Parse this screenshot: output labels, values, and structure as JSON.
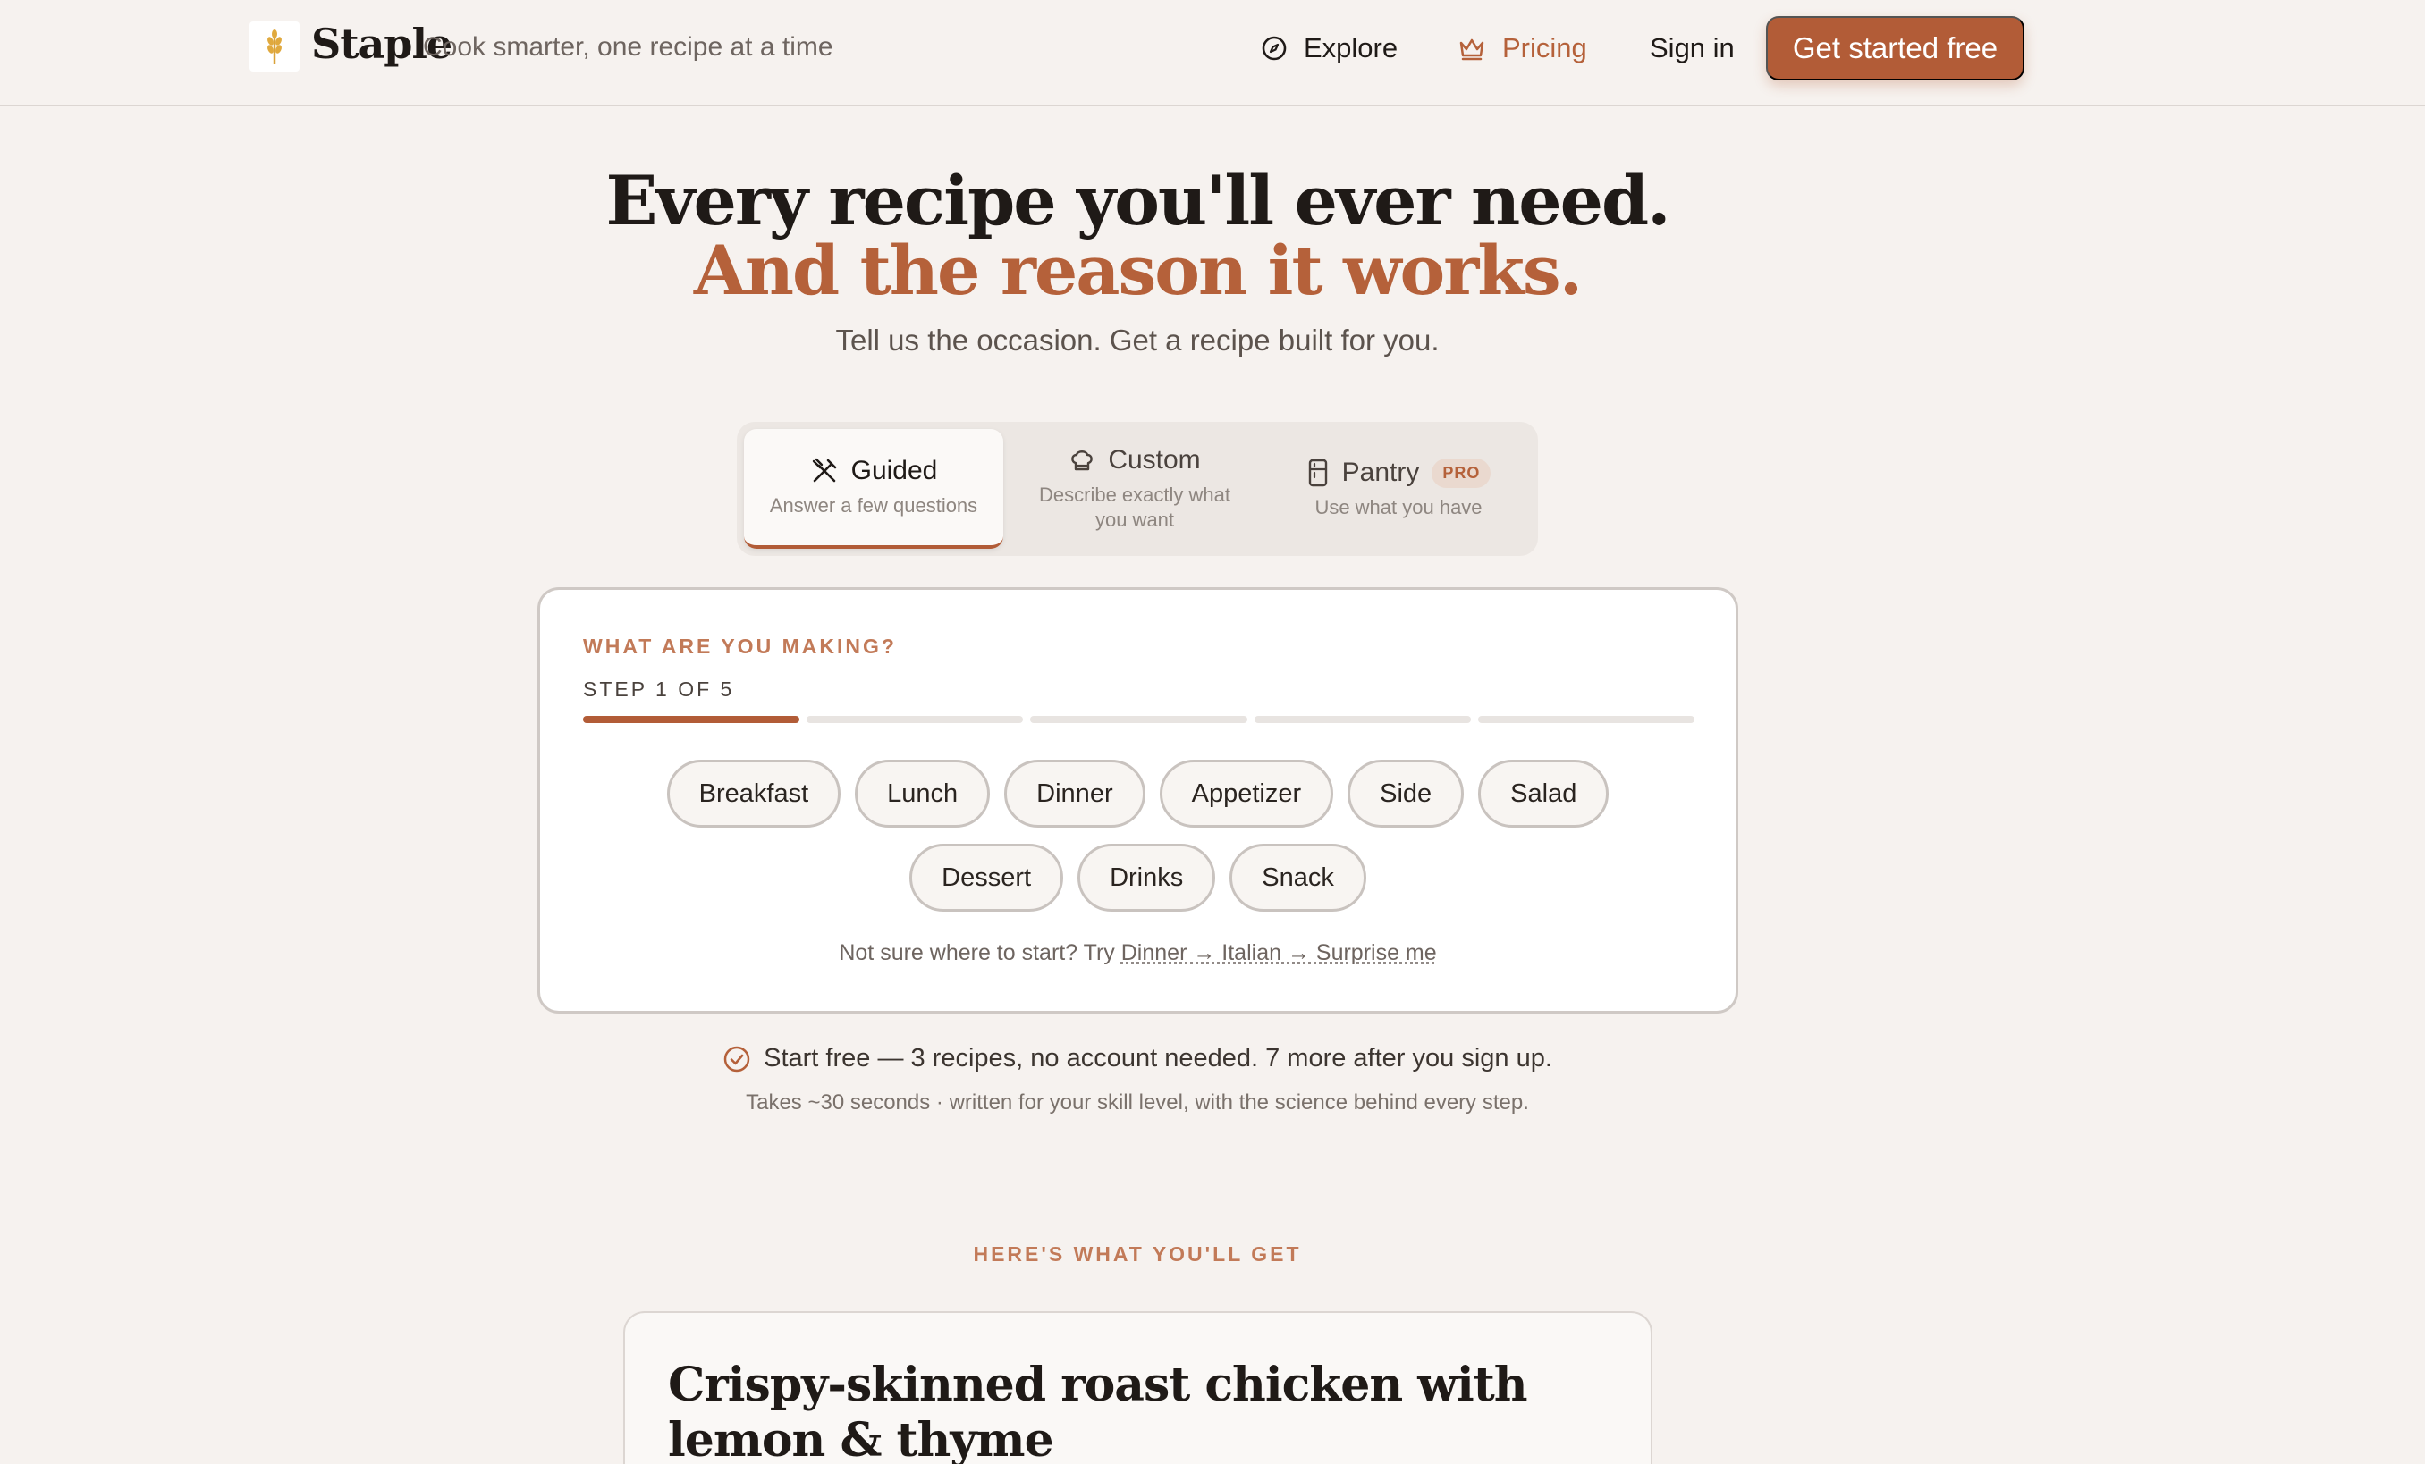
{
  "header": {
    "brand": "Staple",
    "tagline": "Cook smarter, one recipe at a time",
    "nav": {
      "explore": "Explore",
      "pricing": "Pricing",
      "sign_in": "Sign in"
    },
    "cta": "Get started free",
    "icons": {
      "logo": "wheat-icon",
      "explore": "compass-icon",
      "pricing": "crown-icon"
    }
  },
  "hero": {
    "title_line1": "Every recipe you'll ever need.",
    "title_line2": "And the reason it works.",
    "subtitle": "Tell us the occasion. Get a recipe built for you."
  },
  "tabs": [
    {
      "label": "Guided",
      "description": "Answer a few questions",
      "icon": "utensils-crossed-icon",
      "selected": true
    },
    {
      "label": "Custom",
      "description": "Describe exactly what you want",
      "icon": "chef-hat-icon",
      "selected": false
    },
    {
      "label": "Pantry",
      "description": "Use what you have",
      "icon": "fridge-icon",
      "badge": "PRO",
      "selected": false
    }
  ],
  "wizard": {
    "question": "WHAT ARE YOU MAKING?",
    "step_label": "STEP 1 OF 5",
    "step_current": 1,
    "step_total": 5,
    "options": [
      "Breakfast",
      "Lunch",
      "Dinner",
      "Appetizer",
      "Side",
      "Salad",
      "Dessert",
      "Drinks",
      "Snack"
    ],
    "hint_prefix": "Not sure where to start? Try",
    "hint_link": "Dinner → Italian → Surprise me"
  },
  "footer_info": {
    "free_line": "Start free — 3 recipes, no account needed. 7 more after you sign up.",
    "detail": "Takes ~30 seconds · written for your skill level, with the science behind every step."
  },
  "preview": {
    "kicker": "HERE'S WHAT YOU'LL GET",
    "recipe_title": "Crispy-skinned roast chicken with lemon & thyme"
  },
  "colors": {
    "accent": "#b25c37",
    "background": "#f6f2ef",
    "text": "#1f1a17"
  }
}
